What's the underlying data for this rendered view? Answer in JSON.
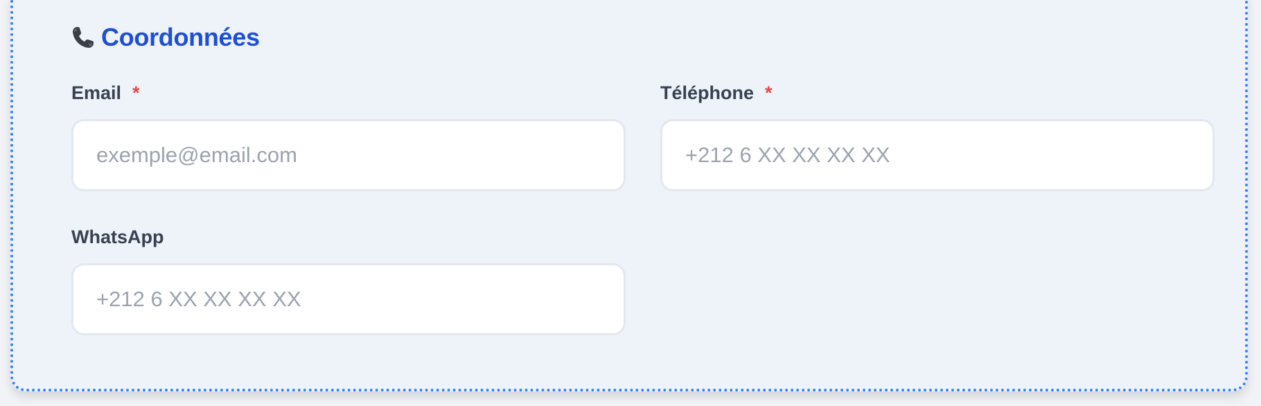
{
  "section": {
    "icon": "telephone-receiver-icon",
    "title": "Coordonnées"
  },
  "fields": {
    "email": {
      "label": "Email",
      "required_mark": "*",
      "placeholder": "exemple@email.com",
      "value": ""
    },
    "phone": {
      "label": "Téléphone",
      "required_mark": "*",
      "placeholder": "+212 6 XX XX XX XX",
      "value": ""
    },
    "whatsapp": {
      "label": "WhatsApp",
      "placeholder": "+212 6 XX XX XX XX",
      "value": ""
    }
  },
  "colors": {
    "accent": "#1d4ed8",
    "border_dotted": "#3b82f6",
    "required": "#ef4444",
    "card_background": "#eef2f9"
  }
}
